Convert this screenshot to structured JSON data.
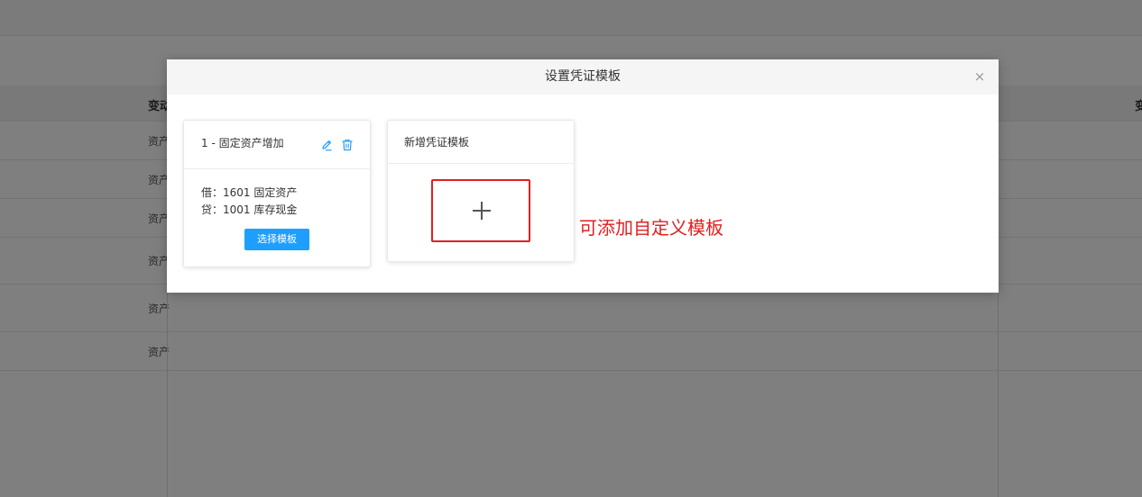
{
  "background": {
    "table_header": {
      "col_left": "变动",
      "col_right": "变"
    },
    "rows": [
      "资产",
      "资产",
      "资产",
      "资产",
      "资产",
      "资产"
    ]
  },
  "dialog": {
    "title": "设置凭证模板",
    "close_glyph": "×",
    "templates": [
      {
        "title": "1 - 固定资产增加",
        "debit": "借：1601 固定资产",
        "credit": "贷：1001 库存现金",
        "select_label": "选择模板"
      }
    ],
    "new_template": {
      "title": "新增凭证模板",
      "add_icon": "plus-icon"
    }
  },
  "annotation": "可添加自定义模板",
  "colors": {
    "accent": "#1e9fff",
    "annotation": "#e02020",
    "overlay": "rgba(0,0,0,0.5)"
  }
}
